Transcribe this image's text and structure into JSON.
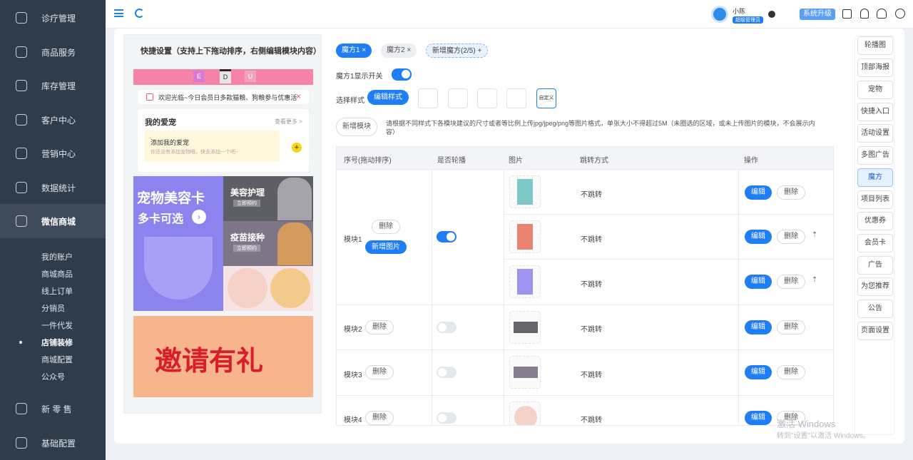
{
  "sidebar": {
    "items": [
      {
        "label": "诊疗管理"
      },
      {
        "label": "商品服务"
      },
      {
        "label": "库存管理"
      },
      {
        "label": "客户中心"
      },
      {
        "label": "营销中心"
      },
      {
        "label": "数据统计"
      },
      {
        "label": "微信商城"
      },
      {
        "label": "新 零 售"
      },
      {
        "label": "基础配置"
      }
    ],
    "sub": [
      {
        "label": "我的账户"
      },
      {
        "label": "商城商品"
      },
      {
        "label": "线上订单"
      },
      {
        "label": "分销员"
      },
      {
        "label": "一件代发"
      },
      {
        "label": "店铺装修"
      },
      {
        "label": "商城配置"
      },
      {
        "label": "公众号"
      }
    ]
  },
  "topbar": {
    "user_name": "小陈",
    "user_role": "超级管理员",
    "upgrade": "系统升级"
  },
  "preview": {
    "title": "快捷设置（支持上下拖动排序，右侧编辑模块内容）",
    "nav_letters": [
      "E",
      "D",
      "U"
    ],
    "notice": "欢迎光临~今日会员日多款猫粮、狗粮参与优惠活",
    "pet_title": "我的爱宠",
    "pet_more": "查看更多 >",
    "pet_add": "添加我的爱宠",
    "pet_hint": "你还没有添加宠物哦，快去添加一个吧~",
    "card_big_title": "宠物美容卡",
    "card_big_sub": "多卡可选",
    "card_r1_title": "美容护理",
    "card_r1_btn": "立即预约",
    "card_r2_title": "疫苗接种",
    "card_r2_btn": "立即预约",
    "banner": "邀请有礼"
  },
  "tabs": [
    {
      "label": "魔方1"
    },
    {
      "label": "魔方2"
    }
  ],
  "add_tab": "新增魔方(2/5) +",
  "show_switch_label": "魔方1显示开关",
  "style_label": "选择样式",
  "style_btn": "编辑样式",
  "custom_style": "自定义",
  "add_module_btn": "新增模块",
  "hint": "请根据不同样式下各模块建议的尺寸或者等比例上传jpg/jpeg/png等图片格式，单张大小不得超过5M（未圈选的区域，或未上传图片的模块，不会展示内容）",
  "table": {
    "headers": [
      "序号(拖动排序)",
      "是否轮播",
      "图片",
      "跳转方式",
      "操作"
    ],
    "jump": "不跳转",
    "edit": "编辑",
    "delete": "删除",
    "add_image": "新增图片",
    "modules": [
      {
        "name": "模块1"
      },
      {
        "name": "模块2"
      },
      {
        "name": "模块3"
      },
      {
        "name": "模块4"
      }
    ]
  },
  "right_panel": [
    "轮播图",
    "顶部海报",
    "宠物",
    "快捷入口",
    "活动设置",
    "多图广告",
    "魔方",
    "项目列表",
    "优惠券",
    "会员卡",
    "广告",
    "为您推荐",
    "公告",
    "页面设置"
  ],
  "watermark": {
    "line1": "激活 Windows",
    "line2": "转到\"设置\"以激活 Windows。"
  }
}
